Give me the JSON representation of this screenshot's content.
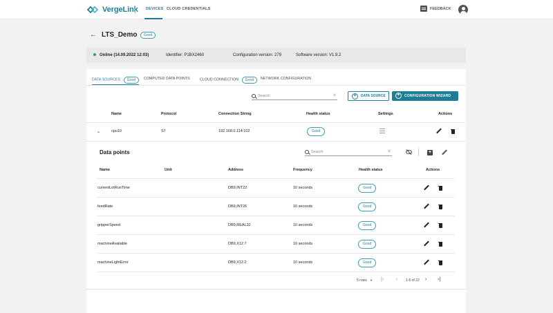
{
  "topbar": {
    "logo_text": "VergeLink",
    "nav": [
      {
        "label": "DEVICES"
      },
      {
        "label": "CLOUD CREDENTIALS"
      }
    ],
    "feedback_label": "FEEDBACK"
  },
  "device": {
    "name": "LTS_Demo",
    "health": "Good",
    "status": "Online (14.09.2022 12:03)",
    "identifier": "Identifier: P1BX2460",
    "config_version": "Configuration version: 279",
    "software_version": "Software version: V1.9.2"
  },
  "tabs": [
    {
      "label": "DATA SOURCES",
      "badge": "Good"
    },
    {
      "label": "COMPUTED DATA POINTS"
    },
    {
      "label": "CLOUD CONNECTION",
      "badge": "Good"
    },
    {
      "label": "NETWORK CONFIGURATION"
    }
  ],
  "toolbar": {
    "search_placeholder": "Search",
    "data_source_label": "DATA SOURCE",
    "wizard_label": "CONFIGURATION WIZARD"
  },
  "sources_table": {
    "columns": [
      "Name",
      "Protocol",
      "Connection String",
      "Health status",
      "Settings",
      "Actions"
    ],
    "rows": [
      {
        "name": "cpu10",
        "protocol": "S7",
        "connection": "192.168.0.114:102",
        "health": "Good"
      }
    ]
  },
  "data_points": {
    "title": "Data points",
    "search_placeholder": "Search",
    "columns": [
      "Name",
      "Unit",
      "Address",
      "Frequency",
      "Health status",
      "Actions"
    ],
    "rows": [
      {
        "name": "currentLotRunTime",
        "unit": "",
        "address": "DB9,INT22",
        "frequency": "10 seconds",
        "health": "Good"
      },
      {
        "name": "feedRate",
        "unit": "",
        "address": "DB9,INT26",
        "frequency": "10 seconds",
        "health": "Good"
      },
      {
        "name": "gripperSpeed",
        "unit": "",
        "address": "DB9,REAL32",
        "frequency": "10 seconds",
        "health": "Good"
      },
      {
        "name": "machineAvailable",
        "unit": "",
        "address": "DB9,X12.7",
        "frequency": "10 seconds",
        "health": "Good"
      },
      {
        "name": "machineLightError",
        "unit": "",
        "address": "DB9,X12.2",
        "frequency": "10 seconds",
        "health": "Good"
      }
    ],
    "pagination": {
      "rows_per_page": "5 rows",
      "range": "1-5 of 22"
    }
  },
  "colors": {
    "accent": "#1e7d97",
    "online": "#2ea44f"
  }
}
